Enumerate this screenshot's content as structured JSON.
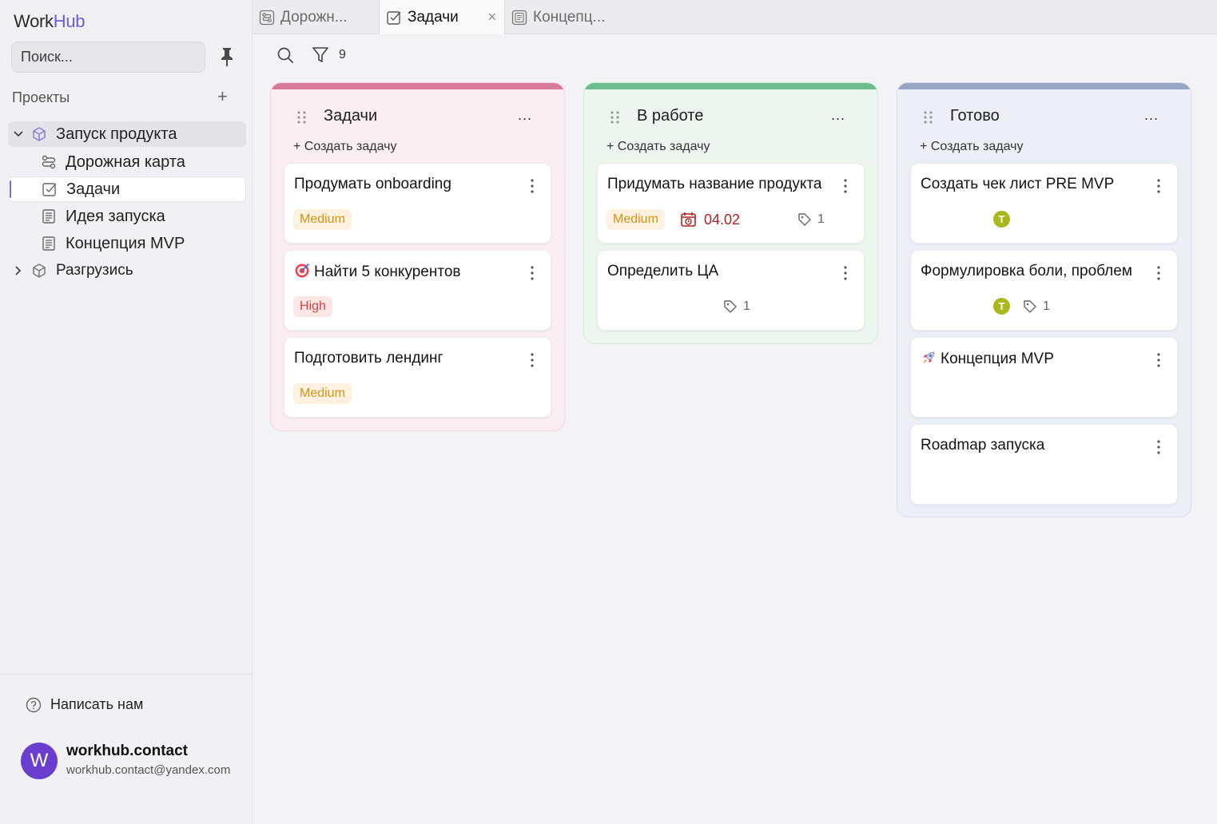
{
  "app": {
    "logo_part1": "Work",
    "logo_part2": "Hub"
  },
  "sidebar": {
    "search_placeholder": "Поиск...",
    "projects_header": "Проекты",
    "add_symbol": "+",
    "project1": {
      "name": "Запуск продукта",
      "children": [
        {
          "label": "Дорожная карта",
          "icon": "roadmap-icon"
        },
        {
          "label": "Задачи",
          "icon": "checkbox-icon"
        },
        {
          "label": "Идея запуска",
          "icon": "document-icon"
        },
        {
          "label": "Концепция MVP",
          "icon": "document-icon"
        }
      ]
    },
    "project2": {
      "name": "Разгрузись"
    },
    "help_label": "Написать нам",
    "user": {
      "initial": "W",
      "name": "workhub.contact",
      "email": "workhub.contact@yandex.com"
    }
  },
  "tabs": [
    {
      "label": "Дорожн...",
      "icon": "roadmap-icon"
    },
    {
      "label": "Задачи",
      "icon": "checkbox-icon",
      "close": "×"
    },
    {
      "label": "Концепц...",
      "icon": "document-icon"
    }
  ],
  "toolbar": {
    "filter_count": "9"
  },
  "columns": [
    {
      "title": "Задачи",
      "more": "...",
      "add_label": "+ Создать задачу",
      "accent": "#d97a9a",
      "cards": [
        {
          "title": "Продумать onboarding",
          "priority": "Medium"
        },
        {
          "title": "Найти 5 конкурентов",
          "emoji": "target",
          "priority": "High"
        },
        {
          "title": "Подготовить лендинг",
          "priority": "Medium"
        }
      ]
    },
    {
      "title": "В работе",
      "more": "...",
      "add_label": "+ Создать задачу",
      "accent": "#6cbc8c",
      "cards": [
        {
          "title": "Придумать название продукта",
          "priority": "Medium",
          "due": "04.02",
          "tags": "1"
        },
        {
          "title": "Определить ЦА",
          "tags": "1"
        }
      ]
    },
    {
      "title": "Готово",
      "more": "...",
      "add_label": "+ Создать задачу",
      "accent": "#98a6c6",
      "cards": [
        {
          "title": "Создать чек лист PRE MVP",
          "assignee": "T"
        },
        {
          "title": "Формулировка боли, проблем",
          "assignee": "T",
          "tags": "1"
        },
        {
          "title": "Концепция MVP",
          "emoji": "rocket"
        },
        {
          "title": "Roadmap запуска"
        }
      ]
    }
  ]
}
